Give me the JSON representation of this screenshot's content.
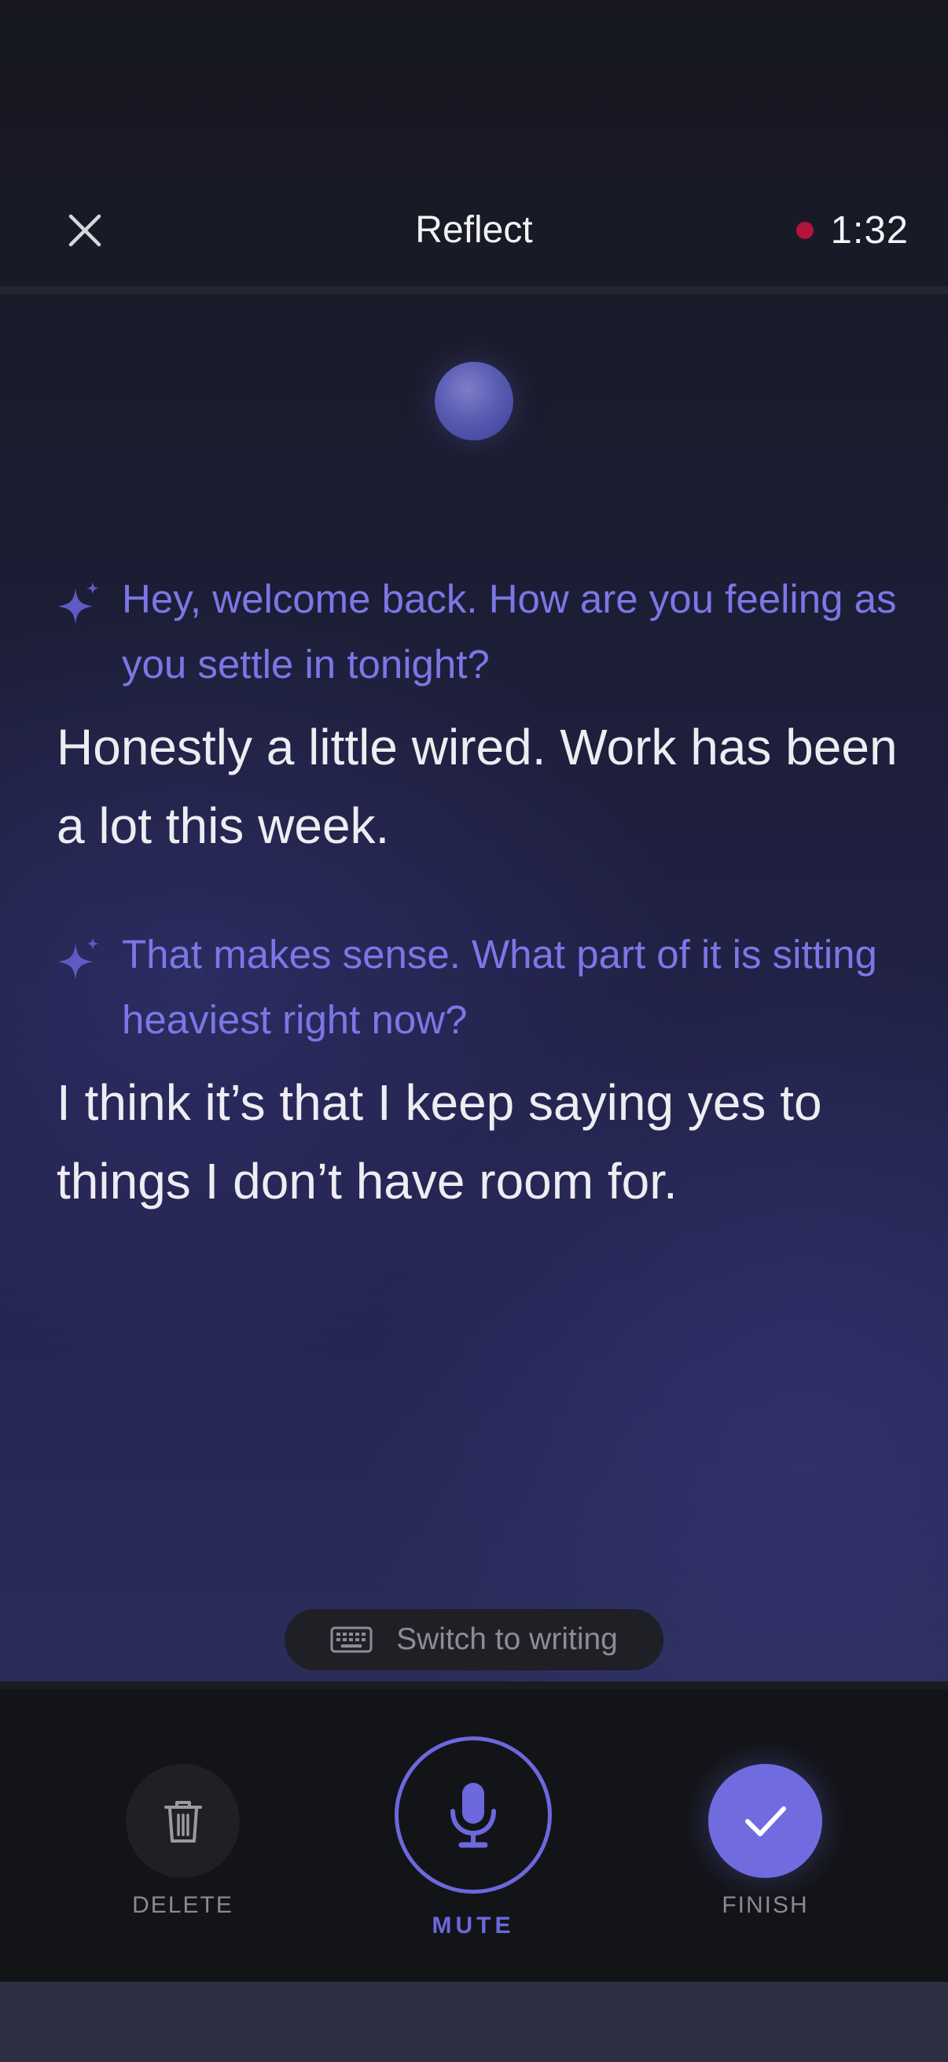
{
  "header": {
    "title": "Reflect",
    "timer": "1:32",
    "close_icon": "close-icon",
    "recording_color": "#b3133b"
  },
  "conversation": [
    {
      "role": "ai",
      "text": "Hey, welcome back. How are you feeling as you settle in tonight?"
    },
    {
      "role": "user",
      "text": "Honestly a little wired. Work has been a lot this week."
    },
    {
      "role": "ai",
      "text": "That makes sense. What part of it is sitting heaviest right now?"
    },
    {
      "role": "user",
      "text": "I think it’s that I keep saying yes to things I don’t have room for."
    }
  ],
  "switch": {
    "label": "Switch to writing",
    "icon": "keyboard-icon"
  },
  "controls": {
    "delete": {
      "label": "DELETE",
      "icon": "trash-icon"
    },
    "mute": {
      "label": "MUTE",
      "icon": "microphone-icon"
    },
    "finish": {
      "label": "FINISH",
      "icon": "checkmark-icon"
    }
  },
  "colors": {
    "accent": "#706ce0",
    "ai_text": "#7b77e6",
    "user_text": "#ededf2"
  }
}
